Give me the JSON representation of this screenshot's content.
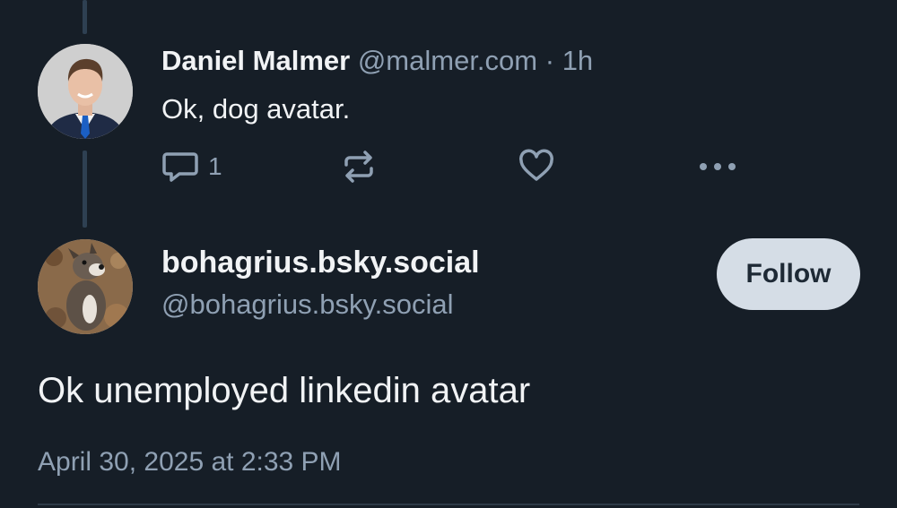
{
  "parent_post": {
    "author_name": "Daniel Malmer",
    "author_handle": "@malmer.com",
    "separator": "·",
    "age": "1h",
    "text": "Ok, dog avatar.",
    "reply_count": "1",
    "avatar": "person-in-suit-avatar"
  },
  "reply_post": {
    "author_name": "bohagrius.bsky.social",
    "author_handle": "@bohagrius.bsky.social",
    "follow_label": "Follow",
    "text": "Ok unemployed linkedin avatar",
    "timestamp": "April 30, 2025 at 2:33 PM",
    "avatar": "dog-avatar"
  },
  "icons": {
    "reply": "speech-bubble-icon",
    "repost": "repost-arrows-icon",
    "like": "heart-icon",
    "more": "ellipsis-icon"
  },
  "colors": {
    "background": "#161e27",
    "text": "#f1f3f5",
    "muted": "#8fa0b3",
    "thread_line": "#2e4052",
    "follow_button_bg": "#d5dde6",
    "follow_button_text": "#1e2935"
  }
}
